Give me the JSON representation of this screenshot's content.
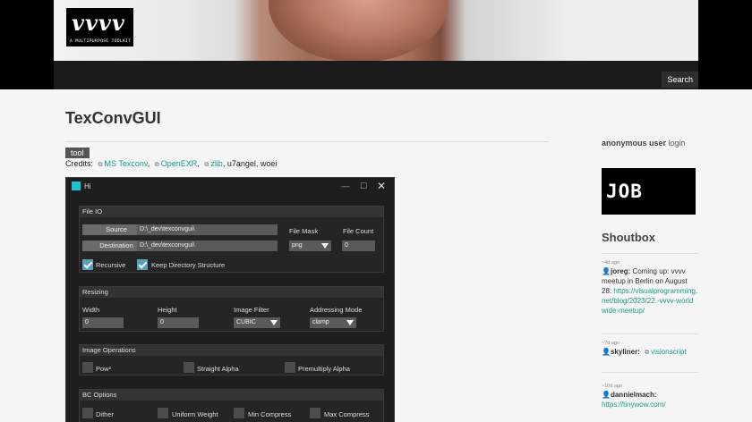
{
  "header": {
    "logo_mark": "vvvv",
    "logo_tagline": "A MULTIPURPOSE TOOLKIT",
    "search_label": "Search"
  },
  "main": {
    "title": "TexConvGUI",
    "tag": "tool",
    "credits_label": "Credits:",
    "credits_links": [
      "MS Texconv",
      "OpenEXR",
      "zlib"
    ],
    "credits_sep": ",",
    "credits_rest": "u7angel, woei"
  },
  "app": {
    "title": "Hi",
    "file_io": {
      "header": "File IO",
      "source_btn": "Source",
      "destination_btn": "Destination",
      "source_path": "D:\\_dev\\texconvgui\\",
      "destination_path": "D:\\_dev\\texconvgui\\",
      "file_mask_label": "File Mask",
      "file_mask_value": "png",
      "file_count_label": "File Count",
      "file_count_value": "0",
      "recursive_label": "Recursive",
      "keep_dir_label": "Keep Directory Structure"
    },
    "resizing": {
      "header": "Resizing",
      "width_label": "Width",
      "width_value": "0",
      "height_label": "Height",
      "height_value": "0",
      "filter_label": "Image Filter",
      "filter_value": "CUBIC",
      "addressing_label": "Addressing Mode",
      "addressing_value": "clamp"
    },
    "image_ops": {
      "header": "Image Operations",
      "pow2_label": "Pow²",
      "straight_alpha_label": "Straight Alpha",
      "premultiply_label": "Premultiply Alpha"
    },
    "bc_options": {
      "header": "BC Options",
      "dither_label": "Dither",
      "uniform_label": "Uniform Weight",
      "min_label": "Min Compress",
      "max_label": "Max Compress"
    }
  },
  "sidebar": {
    "user": "anonymous user",
    "login": "login",
    "job_text": "JOB",
    "shoutbox_title": "Shoutbox",
    "shouts": [
      {
        "ago": "~4d ago",
        "user": "joreg:",
        "text": "Coming up: vvvv meetup in Berlin on August 28:",
        "link": "https://visualprogramming.net/blog/2023/22.-vvvv-worldwide-meetup/"
      },
      {
        "ago": "~7d ago",
        "user": "skyliner:",
        "link": "visionscript"
      },
      {
        "ago": "~10d ago",
        "user": "dannielmach:",
        "link": "https://tinywow.com/"
      }
    ]
  }
}
